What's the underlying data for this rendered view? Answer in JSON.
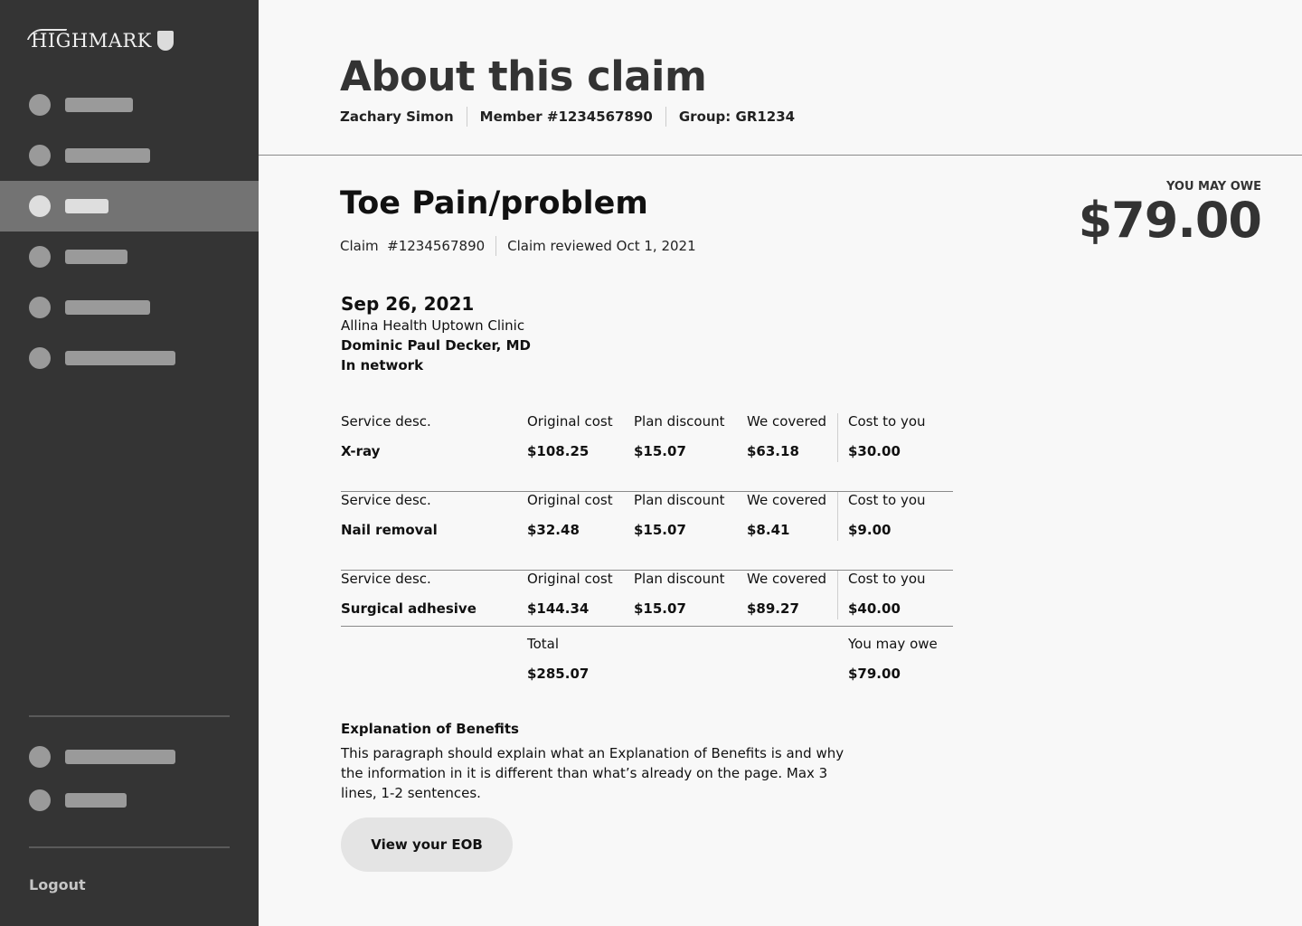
{
  "brand": {
    "logo_text": "HIGHMARK"
  },
  "sidebar": {
    "items": [
      {
        "id": "nav-1",
        "active": false
      },
      {
        "id": "nav-2",
        "active": false
      },
      {
        "id": "nav-3",
        "active": true
      },
      {
        "id": "nav-4",
        "active": false
      },
      {
        "id": "nav-5",
        "active": false
      },
      {
        "id": "nav-6",
        "active": false
      }
    ],
    "secondary_items": [
      {
        "id": "nav-7"
      },
      {
        "id": "nav-8"
      }
    ],
    "logout_label": "Logout"
  },
  "header": {
    "title": "About this claim",
    "member_name": "Zachary Simon",
    "member_number": "Member #1234567890",
    "group": "Group: GR1234"
  },
  "claim": {
    "title": "Toe Pain/problem",
    "claim_number": "Claim  #1234567890",
    "reviewed": "Claim reviewed Oct 1, 2021",
    "owe_label": "YOU MAY OWE",
    "owe_amount": "$79.00"
  },
  "visit": {
    "date": "Sep 26, 2021",
    "facility": "Allina Health Uptown Clinic",
    "provider": "Dominic Paul Decker, MD",
    "network": "In network"
  },
  "table": {
    "headers": [
      "Service desc.",
      "Original cost",
      "Plan discount",
      "We covered",
      "Cost to you"
    ],
    "rows": [
      {
        "service": "X-ray",
        "original": "$108.25",
        "discount": "$15.07",
        "covered": "$63.18",
        "cost": "$30.00"
      },
      {
        "service": "Nail removal",
        "original": "$32.48",
        "discount": "$15.07",
        "covered": "$8.41",
        "cost": "$9.00"
      },
      {
        "service": "Surgical adhesive",
        "original": "$144.34",
        "discount": "$15.07",
        "covered": "$89.27",
        "cost": "$40.00"
      }
    ],
    "total_label": "Total",
    "total_value": "$285.07",
    "owe_label": "You may owe",
    "owe_value": "$79.00"
  },
  "eob": {
    "title": "Explanation of Benefits",
    "text": "This paragraph should explain what an Explanation of Benefits is and why the information in it is different than what’s already on the page. Max 3 lines, 1-2 sentences.",
    "button_label": "View your EOB"
  },
  "colors": {
    "sidebar_bg": "#343434",
    "sidebar_active": "#737373",
    "page_bg": "#f8f8f8"
  }
}
